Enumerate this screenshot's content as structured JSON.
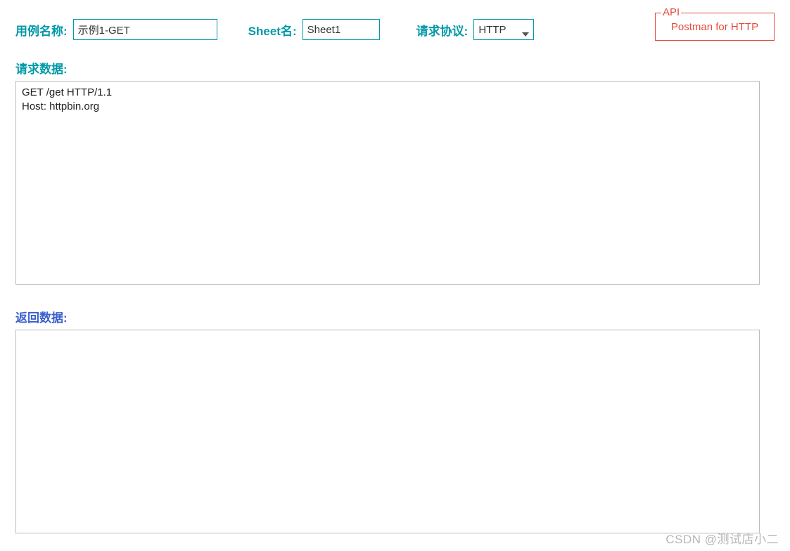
{
  "labels": {
    "case_name": "用例名称:",
    "sheet_name": "Sheet名:",
    "protocol": "请求协议:",
    "request_data": "请求数据:",
    "response_data": "返回数据:"
  },
  "values": {
    "case_name": "示例1-GET",
    "sheet_name": "Sheet1",
    "protocol": "HTTP",
    "request_body": "GET /get HTTP/1.1\nHost: httpbin.org",
    "response_body": ""
  },
  "api_box": {
    "legend": "API",
    "text": "Postman for HTTP"
  },
  "watermark": "CSDN @测试店小二"
}
